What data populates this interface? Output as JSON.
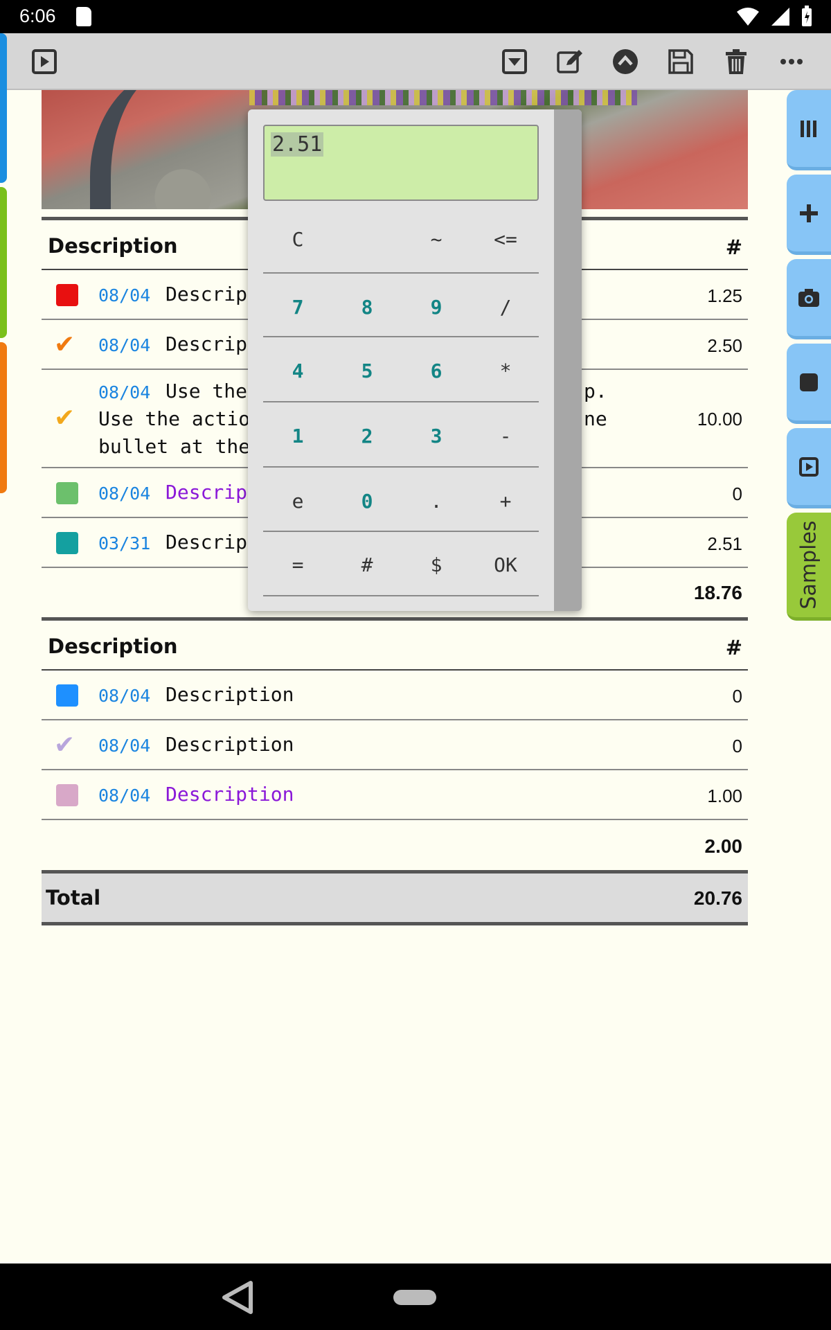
{
  "status_bar": {
    "time": "6:06"
  },
  "toolbar": {
    "icons": [
      "play-icon",
      "dropdown-icon",
      "edit-icon",
      "collapse-icon",
      "save-icon",
      "trash-icon",
      "more-icon"
    ]
  },
  "sections": [
    {
      "header": {
        "title": "Description",
        "col": "#"
      },
      "rows": [
        {
          "marker": "square",
          "color": "#e81010",
          "date": "08/04",
          "desc": "Descripti",
          "value": "1.25"
        },
        {
          "marker": "check",
          "color": "#f07a10",
          "date": "08/04",
          "desc": "Descripti",
          "value": "2.50"
        },
        {
          "marker": "check",
          "color": "#f2a81c",
          "date": "08/04",
          "desc": "Use the",
          "desc_suffix": "p.",
          "line2": "Use the action t",
          "line2_suffix": "ne",
          "line3": "bullet at the left",
          "value": "10.00"
        },
        {
          "marker": "square",
          "color": "#6cc06c",
          "date": "08/04",
          "desc": "Descripti",
          "value": "0"
        },
        {
          "marker": "square",
          "color": "#14a0a0",
          "date": "03/31",
          "desc": "Descripti",
          "value": "2.51"
        }
      ],
      "subtotal": "18.76"
    },
    {
      "header": {
        "title": "Description",
        "col": "#"
      },
      "rows": [
        {
          "marker": "square",
          "color": "#1e90ff",
          "date": "08/04",
          "desc": "Description",
          "value": "0"
        },
        {
          "marker": "check",
          "color": "#b8a6dc",
          "date": "08/04",
          "desc": "Description",
          "value": "0"
        },
        {
          "marker": "square",
          "color": "#d8a8c8",
          "date": "08/04",
          "desc": "Description",
          "value": "1.00"
        }
      ],
      "subtotal": "2.00"
    }
  ],
  "total": {
    "label": "Total",
    "value": "20.76"
  },
  "side_tabs": {
    "samples_label": "Samples"
  },
  "calculator": {
    "display": "2.51",
    "keys": [
      [
        "C",
        "",
        "~",
        "<="
      ],
      [
        "7",
        "8",
        "9",
        "/"
      ],
      [
        "4",
        "5",
        "6",
        "*"
      ],
      [
        "1",
        "2",
        "3",
        "-"
      ],
      [
        "e",
        "0",
        ".",
        "+"
      ],
      [
        "=",
        "#",
        "$",
        "OK"
      ]
    ]
  }
}
